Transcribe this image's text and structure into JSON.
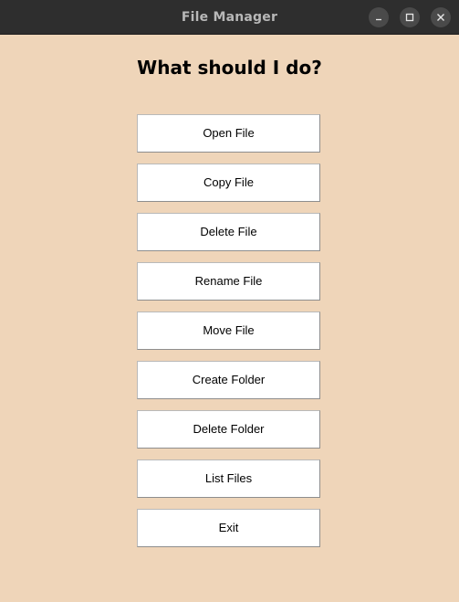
{
  "window": {
    "title": "File Manager",
    "controls": [
      "minimize-icon",
      "maximize-icon",
      "close-icon"
    ]
  },
  "main": {
    "heading": "What should I do?"
  },
  "buttons": [
    {
      "label": "Open File"
    },
    {
      "label": "Copy File"
    },
    {
      "label": "Delete File"
    },
    {
      "label": "Rename File"
    },
    {
      "label": "Move File"
    },
    {
      "label": "Create Folder"
    },
    {
      "label": "Delete Folder"
    },
    {
      "label": "List Files"
    },
    {
      "label": "Exit"
    }
  ],
  "colors": {
    "background": "#efd5b9",
    "titlebar": "#2e2e2e",
    "button": "#ffffff"
  }
}
